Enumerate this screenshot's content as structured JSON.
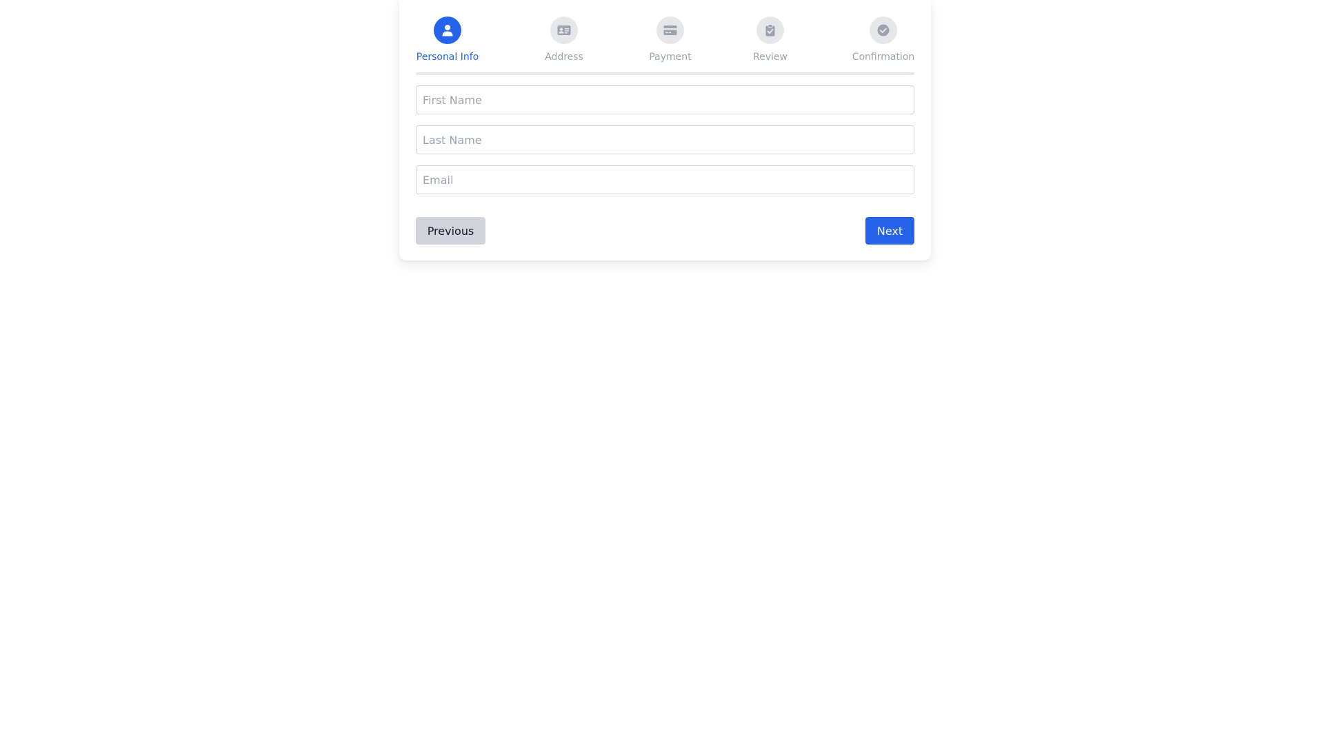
{
  "stepper": {
    "steps": [
      {
        "label": "Personal Info",
        "icon": "user-icon",
        "active": true
      },
      {
        "label": "Address",
        "icon": "address-card-icon",
        "active": false
      },
      {
        "label": "Payment",
        "icon": "credit-card-icon",
        "active": false
      },
      {
        "label": "Review",
        "icon": "clipboard-check-icon",
        "active": false
      },
      {
        "label": "Confirmation",
        "icon": "check-circle-icon",
        "active": false
      }
    ]
  },
  "form": {
    "first_name": {
      "placeholder": "First Name",
      "value": ""
    },
    "last_name": {
      "placeholder": "Last Name",
      "value": ""
    },
    "email": {
      "placeholder": "Email",
      "value": ""
    }
  },
  "buttons": {
    "previous_label": "Previous",
    "next_label": "Next"
  },
  "colors": {
    "accent": "#2563eb",
    "inactive": "#9ca3af",
    "inactive_bg": "#e5e7eb",
    "secondary_button": "#d1d5db"
  }
}
